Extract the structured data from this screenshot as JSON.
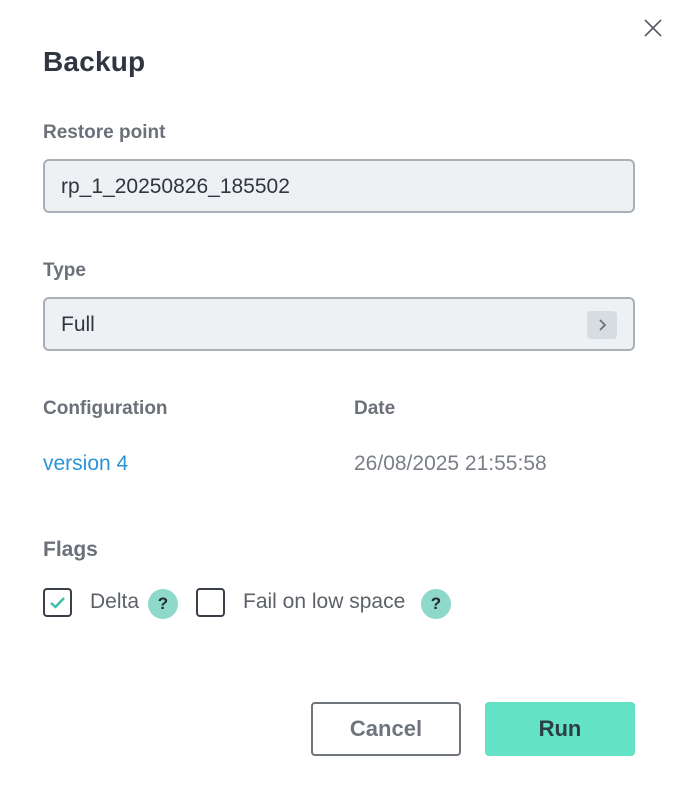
{
  "dialog": {
    "title": "Backup",
    "close_icon": "close-icon"
  },
  "restore_point": {
    "label": "Restore point",
    "value": "rp_1_20250826_185502"
  },
  "type": {
    "label": "Type",
    "value": "Full",
    "icon": "chevron-right-icon"
  },
  "info": {
    "configuration_label": "Configuration",
    "configuration_value": "version 4",
    "date_label": "Date",
    "date_value": "26/08/2025 21:55:58"
  },
  "flags": {
    "label": "Flags",
    "items": [
      {
        "label": "Delta",
        "checked": true,
        "help": "?"
      },
      {
        "label": "Fail on low space",
        "checked": false,
        "help": "?"
      }
    ]
  },
  "buttons": {
    "cancel": "Cancel",
    "run": "Run"
  },
  "colors": {
    "accent": "#63e2c6",
    "help_badge": "#8fd8cc",
    "link": "#2a95d5",
    "check": "#3cbfa6"
  }
}
